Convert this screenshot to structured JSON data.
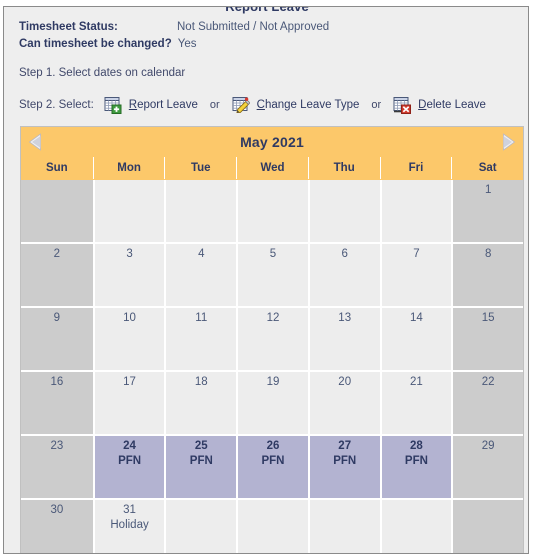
{
  "panel": {
    "legend": "Report Leave"
  },
  "status": {
    "timesheet_status_label": "Timesheet Status:",
    "timesheet_status_value": "Not Submitted / Not Approved",
    "can_change_label": "Can timesheet be changed?",
    "can_change_value": "Yes"
  },
  "steps": {
    "step1": "Step 1. Select dates on calendar",
    "step2_label": "Step 2. Select:",
    "or": "or",
    "actions": [
      {
        "accesskey": "R",
        "rest": "eport Leave",
        "icon": "calendar-add-icon"
      },
      {
        "accesskey": "C",
        "rest": "hange Leave Type",
        "icon": "calendar-edit-icon"
      },
      {
        "accesskey": "D",
        "rest": "elete Leave",
        "icon": "calendar-delete-icon"
      }
    ]
  },
  "calendar": {
    "month_title": "May 2021",
    "prev_icon": "triangle-left-icon",
    "next_icon": "triangle-right-icon",
    "day_headers": [
      "Sun",
      "Mon",
      "Tue",
      "Wed",
      "Thu",
      "Fri",
      "Sat"
    ],
    "weeks": [
      [
        {
          "day": "",
          "note": "",
          "kind": "empty-weekend"
        },
        {
          "day": "",
          "note": "",
          "kind": "empty"
        },
        {
          "day": "",
          "note": "",
          "kind": "empty"
        },
        {
          "day": "",
          "note": "",
          "kind": "empty"
        },
        {
          "day": "",
          "note": "",
          "kind": "empty"
        },
        {
          "day": "",
          "note": "",
          "kind": "empty"
        },
        {
          "day": "1",
          "note": "",
          "kind": "weekend"
        }
      ],
      [
        {
          "day": "2",
          "note": "",
          "kind": "weekend"
        },
        {
          "day": "3",
          "note": "",
          "kind": "weekday"
        },
        {
          "day": "4",
          "note": "",
          "kind": "weekday"
        },
        {
          "day": "5",
          "note": "",
          "kind": "weekday"
        },
        {
          "day": "6",
          "note": "",
          "kind": "weekday"
        },
        {
          "day": "7",
          "note": "",
          "kind": "weekday"
        },
        {
          "day": "8",
          "note": "",
          "kind": "weekend"
        }
      ],
      [
        {
          "day": "9",
          "note": "",
          "kind": "weekend"
        },
        {
          "day": "10",
          "note": "",
          "kind": "weekday"
        },
        {
          "day": "11",
          "note": "",
          "kind": "weekday"
        },
        {
          "day": "12",
          "note": "",
          "kind": "weekday"
        },
        {
          "day": "13",
          "note": "",
          "kind": "weekday"
        },
        {
          "day": "14",
          "note": "",
          "kind": "weekday"
        },
        {
          "day": "15",
          "note": "",
          "kind": "weekend"
        }
      ],
      [
        {
          "day": "16",
          "note": "",
          "kind": "weekend"
        },
        {
          "day": "17",
          "note": "",
          "kind": "weekday"
        },
        {
          "day": "18",
          "note": "",
          "kind": "weekday"
        },
        {
          "day": "19",
          "note": "",
          "kind": "weekday"
        },
        {
          "day": "20",
          "note": "",
          "kind": "weekday"
        },
        {
          "day": "21",
          "note": "",
          "kind": "weekday"
        },
        {
          "day": "22",
          "note": "",
          "kind": "weekend"
        }
      ],
      [
        {
          "day": "23",
          "note": "",
          "kind": "weekend"
        },
        {
          "day": "24",
          "note": "PFN",
          "kind": "selected"
        },
        {
          "day": "25",
          "note": "PFN",
          "kind": "selected"
        },
        {
          "day": "26",
          "note": "PFN",
          "kind": "selected"
        },
        {
          "day": "27",
          "note": "PFN",
          "kind": "selected"
        },
        {
          "day": "28",
          "note": "PFN",
          "kind": "selected"
        },
        {
          "day": "29",
          "note": "",
          "kind": "weekend"
        }
      ],
      [
        {
          "day": "30",
          "note": "",
          "kind": "weekend"
        },
        {
          "day": "31",
          "note": "Holiday",
          "kind": "weekday"
        },
        {
          "day": "",
          "note": "",
          "kind": "empty"
        },
        {
          "day": "",
          "note": "",
          "kind": "empty"
        },
        {
          "day": "",
          "note": "",
          "kind": "empty"
        },
        {
          "day": "",
          "note": "",
          "kind": "empty"
        },
        {
          "day": "",
          "note": "",
          "kind": "empty-weekend"
        }
      ]
    ]
  },
  "colors": {
    "header_orange": "#fcc86a",
    "selected_lavender": "#b3b3d1",
    "weekend_gray": "#cccccc",
    "weekday_gray": "#ededed",
    "text_navy": "#2f3a63",
    "panel_bg": "#eeeeee"
  }
}
